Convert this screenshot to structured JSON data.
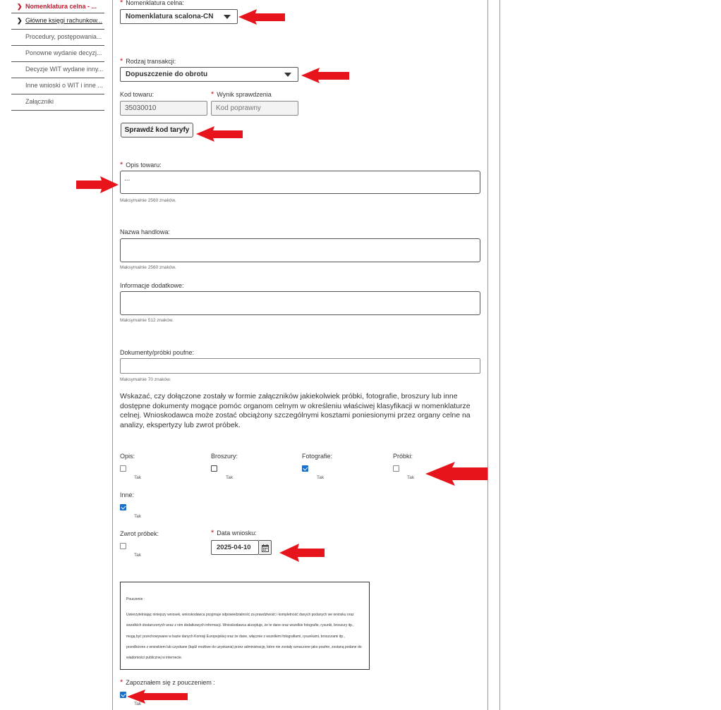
{
  "sidebar": {
    "items": [
      {
        "label": "Nomenklatura celna - ..."
      },
      {
        "label": "Główne księgi rachunkow..."
      },
      {
        "label": "Procedury, postępowania..."
      },
      {
        "label": "Ponowne wydanie decyzj..."
      },
      {
        "label": "Decyzje WIT wydane inny..."
      },
      {
        "label": "Inne wnioski o WIT i inne ..."
      },
      {
        "label": "Załączniki"
      }
    ]
  },
  "form": {
    "required_mark": "*",
    "nomenklatura": {
      "label": "Nomenklatura celna:",
      "value": "Nomenklatura scalona-CN"
    },
    "rodzaj": {
      "label": "Rodzaj transakcji:",
      "value": "Dopuszczenie do obrotu"
    },
    "kod_towaru": {
      "label": "Kod towaru:",
      "value": "35030010"
    },
    "wynik": {
      "label": "Wynik sprawdzenia",
      "placeholder": "Kod poprawny"
    },
    "sprawdz_button": "Sprawdź kod taryfy",
    "opis": {
      "label": "Opis towaru:",
      "value": "...",
      "hint": "Maksymalnie 2560 znaków."
    },
    "nazwa": {
      "label": "Nazwa handlowa:",
      "hint": "Maksymalnie 2560 znaków."
    },
    "informacje": {
      "label": "Informacje dodatkowe:",
      "hint": "Maksymalnie 512 znaków."
    },
    "dokumenty": {
      "label": "Dokumenty/próbki poufne:",
      "hint": "Maksymalnie 70 znaków."
    },
    "instruction": "Wskazać, czy dołączone zostały w formie załączników jakiekolwiek próbki, fotografie, broszury lub inne dostępne dokumenty mogące pomóc organom celnym w określeniu właściwej klasyfikacji w nomenklaturze celnej. Wnioskodawca może zostać obciążony szczególnymi kosztami poniesionymi przez organy celne na analizy, ekspertyzy lub zwrot próbek.",
    "checkbox_tak": "Tak",
    "checkboxes": [
      {
        "label": "Opis:",
        "checked": false
      },
      {
        "label": "Broszury:",
        "checked": false
      },
      {
        "label": "Fotografie:",
        "checked": true
      },
      {
        "label": "Próbki:",
        "checked": false
      },
      {
        "label": "Inne:",
        "checked": true
      },
      {
        "label": "Zwrot próbek:",
        "checked": false
      }
    ],
    "data_wniosku": {
      "label": "Data wniosku:",
      "value": "2025-04-10"
    },
    "pouczenie": {
      "title": "Pouczenie :",
      "body": "Uwierzytelniając niniejszy wniosek, wnioskodawca przyjmuje odpowiedzialność za prawdziwość i kompletność danych podanych we wniosku oraz wszelkich dostarczonych wraz z nim dodatkowych informacji. Wnioskodawca akceptuje, że te dane oraz wszelkie fotografie, rysunki, broszury itp., mogą być przechowywane w bazie danych Komisji Europejskiej oraz że dane, włącznie z wszelkimi fotografiami, rysunkami, broszurami itp., przedłożone z wnioskiem lub uzyskane (bądź możliwe do uzyskania) przez administrację, które nie zostały oznaczone jako poufne, zostaną podane do wiadomości publicznej w internecie."
    },
    "zapoznalem": {
      "label": "Zapoznałem się z pouczeniem :",
      "checked": true
    }
  },
  "colors": {
    "accent": "#c0182c",
    "arrow": "#e8141c",
    "checkbox": "#1a6fc9"
  }
}
